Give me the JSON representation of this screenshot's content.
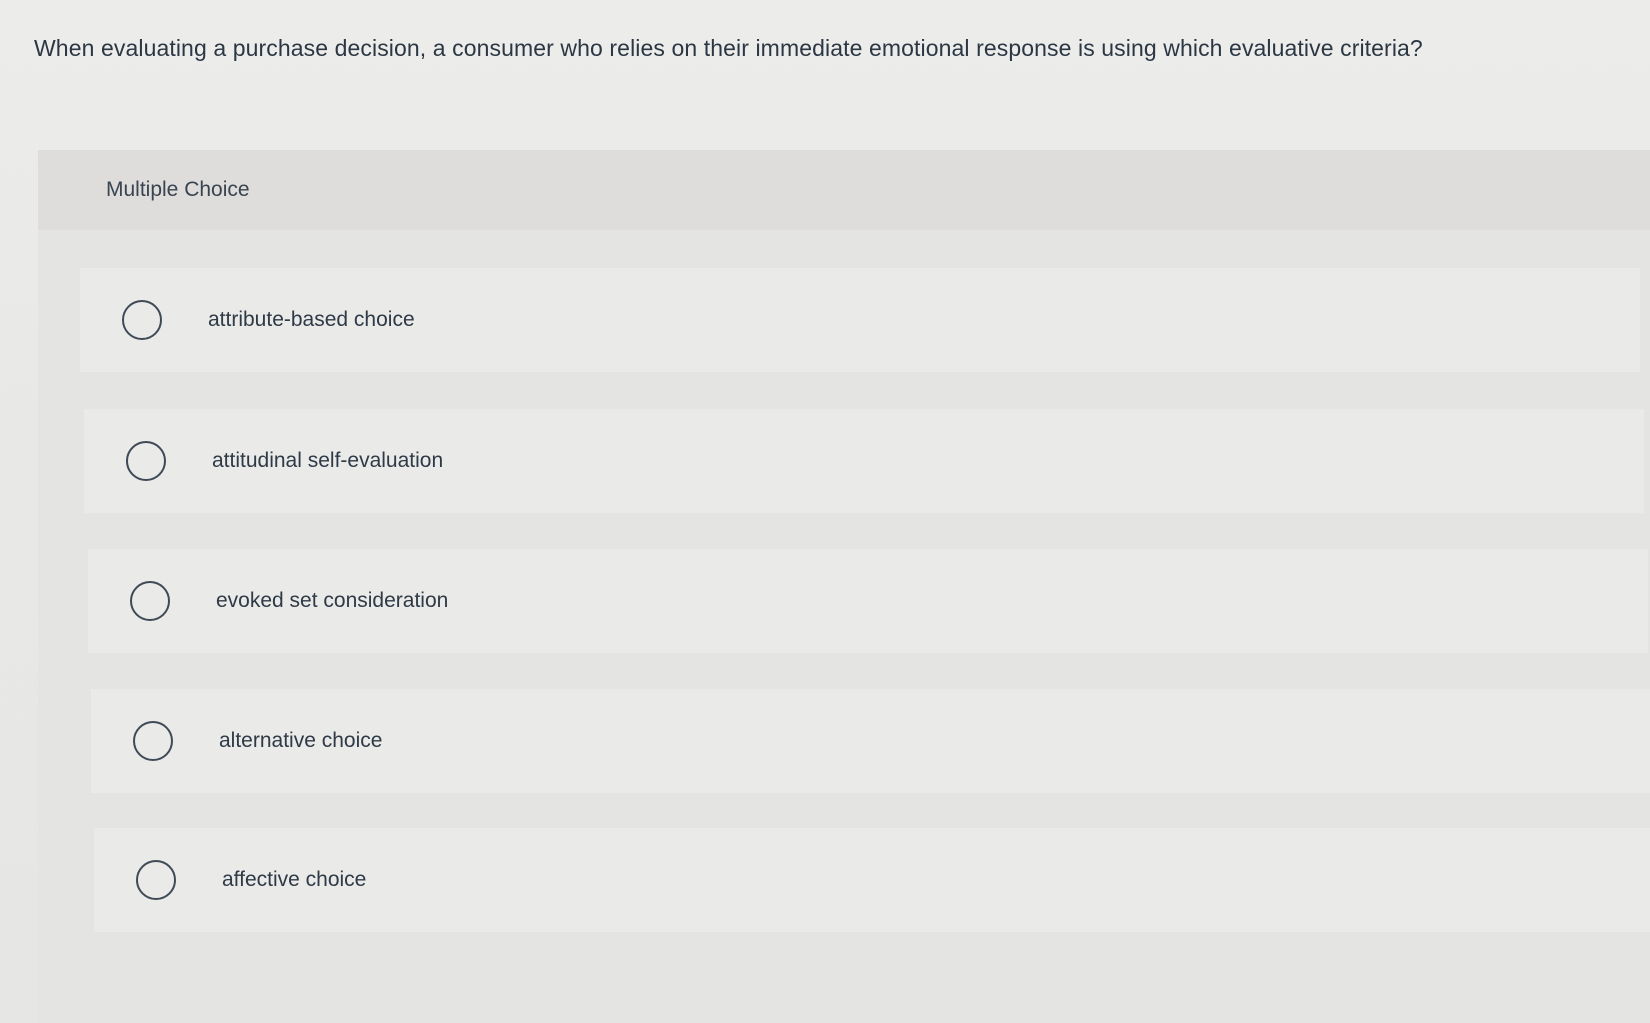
{
  "question": {
    "text": "When evaluating a purchase decision, a consumer who relies on their immediate emotional response is using which evaluative criteria?"
  },
  "multiple_choice": {
    "label": "Multiple Choice",
    "options": [
      {
        "label": "attribute-based choice",
        "selected": false
      },
      {
        "label": "attitudinal self-evaluation",
        "selected": false
      },
      {
        "label": "evoked set consideration",
        "selected": false
      },
      {
        "label": "alternative choice",
        "selected": false
      },
      {
        "label": "affective choice",
        "selected": false
      }
    ]
  },
  "colors": {
    "background": "#e8e8e6",
    "panel": "#e1e1df",
    "option_row": "#eaeae8",
    "text": "#2f3a47",
    "radio_border": "#3f4a56"
  },
  "icons": {
    "radio": "radio-unchecked-icon"
  }
}
